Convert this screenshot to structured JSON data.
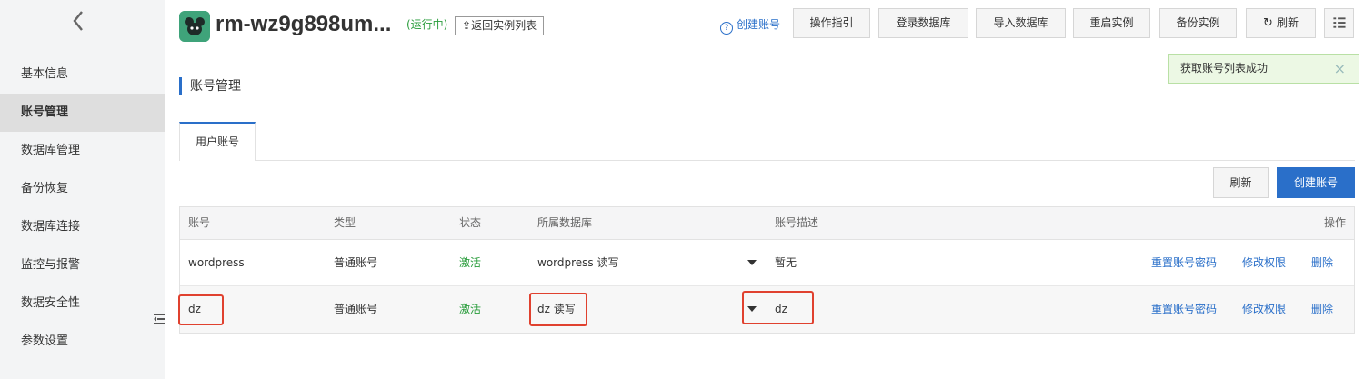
{
  "sidebar": {
    "items": [
      {
        "label": "基本信息",
        "active": false
      },
      {
        "label": "账号管理",
        "active": true
      },
      {
        "label": "数据库管理",
        "active": false
      },
      {
        "label": "备份恢复",
        "active": false
      },
      {
        "label": "数据库连接",
        "active": false
      },
      {
        "label": "监控与报警",
        "active": false
      },
      {
        "label": "数据安全性",
        "active": false
      },
      {
        "label": "参数设置",
        "active": false
      }
    ]
  },
  "header": {
    "instance_name": "rm-wz9g898um...",
    "status": "(运行中)",
    "back_label": "返回实例列表",
    "help_label": "创建账号",
    "buttons": {
      "guide": "操作指引",
      "login_db": "登录数据库",
      "import_db": "导入数据库",
      "restart": "重启实例",
      "backup": "备份实例",
      "refresh": "刷新"
    }
  },
  "toast": {
    "message": "获取账号列表成功",
    "close": "×"
  },
  "section": {
    "title": "账号管理"
  },
  "tabs": [
    {
      "label": "用户账号",
      "active": true
    }
  ],
  "toolbar": {
    "refresh_label": "刷新",
    "create_label": "创建账号"
  },
  "table": {
    "headers": {
      "account": "账号",
      "type": "类型",
      "status": "状态",
      "databases": "所属数据库",
      "description": "账号描述",
      "actions": "操作"
    },
    "rows": [
      {
        "account": "wordpress",
        "type": "普通账号",
        "status": "激活",
        "databases": "wordpress 读写",
        "description": "暂无",
        "actions": {
          "reset_password": "重置账号密码",
          "modify_permissions": "修改权限",
          "delete": "删除"
        }
      },
      {
        "account": "dz",
        "type": "普通账号",
        "status": "激活",
        "databases": "dz 读写",
        "description": "dz",
        "actions": {
          "reset_password": "重置账号密码",
          "modify_permissions": "修改权限",
          "delete": "删除"
        }
      }
    ]
  },
  "colors": {
    "accent": "#2a6fc9",
    "success": "#2a9d3c",
    "highlight": "#e0412f",
    "logo": "#3fa37a"
  }
}
